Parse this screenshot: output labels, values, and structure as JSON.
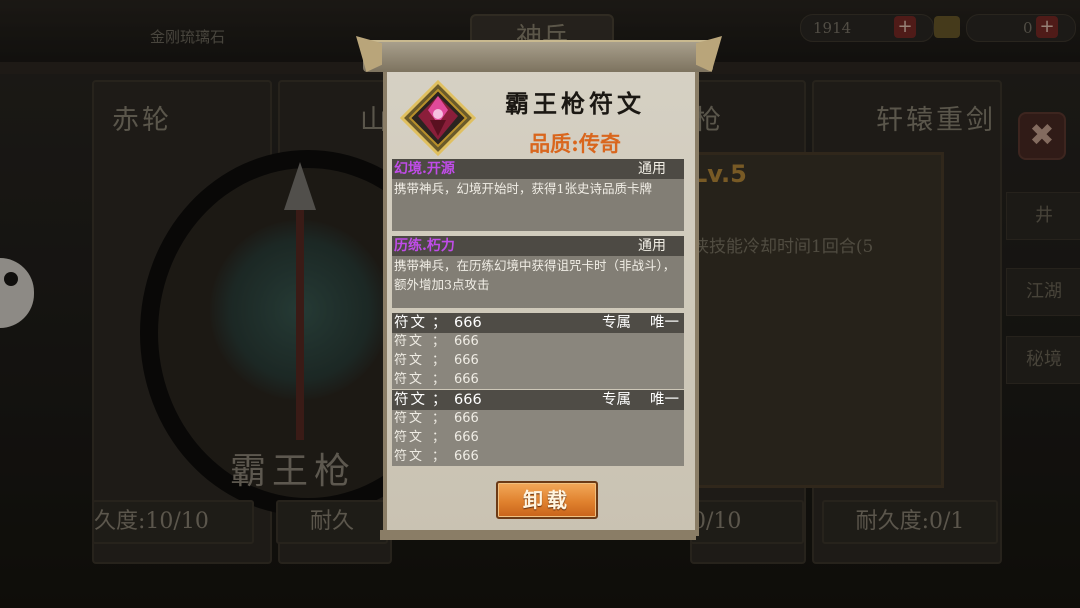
{
  "topbar": {
    "resource_label": "金刚琉璃石",
    "title": "神兵",
    "currency_1": "1914",
    "currency_2": "0",
    "plus_icon": "+"
  },
  "weapon_cards": {
    "names": [
      "赤轮",
      "山",
      "枪",
      "轩辕重剑"
    ],
    "durability": [
      "久度:10/10",
      "耐久",
      "0/10",
      "耐久度:0/1"
    ]
  },
  "background_detail": {
    "selected_weapon_name": "霸王枪",
    "level": "Lv.5",
    "description": "侠技能冷却时间1回合(5"
  },
  "sidebar": {
    "items": [
      "井",
      "江湖",
      "秘境"
    ],
    "close_icon": "✖"
  },
  "popup": {
    "title": "霸王枪符文",
    "quality": "品质:传奇",
    "sections": [
      {
        "name": "幻境.开源",
        "tag": "通用",
        "text": "携带神兵，幻境开始时，获得1张史诗品质卡牌"
      },
      {
        "name": "历练.朽力",
        "tag": "通用",
        "text": "携带神兵，在历练幻境中获得诅咒卡时（非战斗），额外增加3点攻击"
      }
    ],
    "rune_groups": [
      {
        "header": {
          "label": "符文",
          "sep": "；",
          "value": "666",
          "tag1": "专属",
          "tag2": "唯一"
        },
        "rows": [
          {
            "label": "符文",
            "sep": "；",
            "value": "666"
          },
          {
            "label": "符文",
            "sep": "；",
            "value": "666"
          },
          {
            "label": "符文",
            "sep": "；",
            "value": "666"
          }
        ]
      },
      {
        "header": {
          "label": "符文",
          "sep": "；",
          "value": "666",
          "tag1": "专属",
          "tag2": "唯一"
        },
        "rows": [
          {
            "label": "符文",
            "sep": "；",
            "value": "666"
          },
          {
            "label": "符文",
            "sep": "；",
            "value": "666"
          },
          {
            "label": "符文",
            "sep": "；",
            "value": "666"
          }
        ]
      }
    ],
    "unload_button": "卸载"
  },
  "colors": {
    "quality_orange": "#d9661d",
    "section_purple": "#c04ce8",
    "button_orange": "#e0822e",
    "paper": "#d6d1c4"
  }
}
